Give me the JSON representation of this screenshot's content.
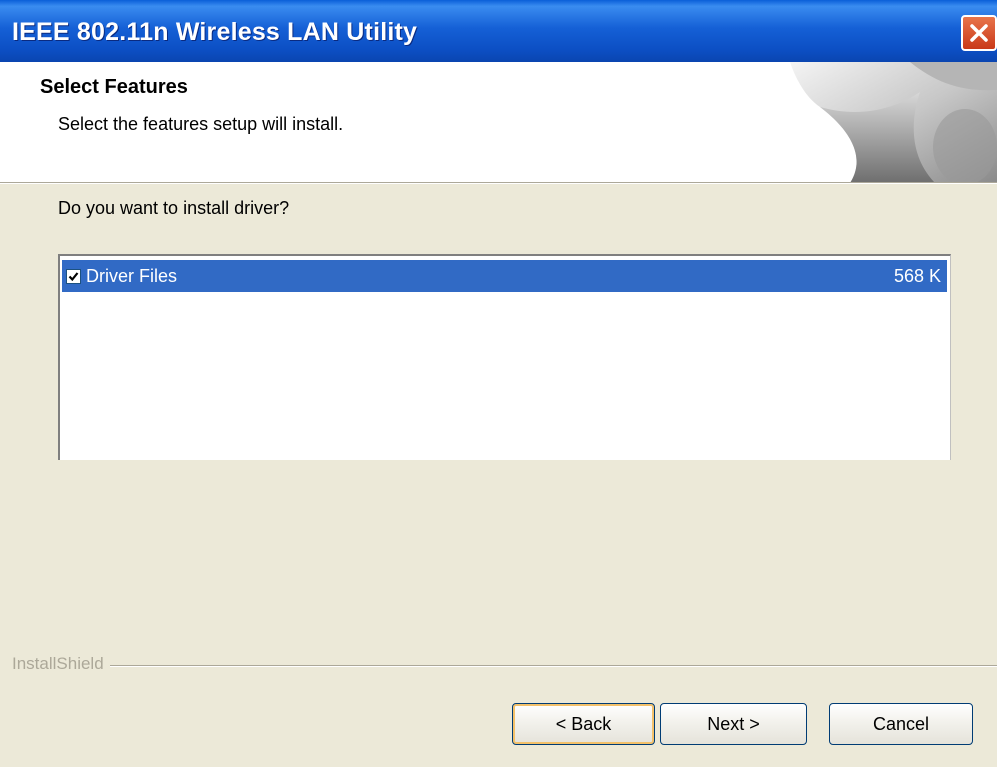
{
  "window": {
    "title": "IEEE 802.11n Wireless LAN Utility",
    "close_icon": "close-x"
  },
  "header": {
    "title": "Select Features",
    "subtitle": "Select the features setup will install."
  },
  "main": {
    "question": "Do you want to install driver?",
    "features": [
      {
        "label": "Driver Files",
        "size": "568 K",
        "checked": true,
        "selected": true
      }
    ]
  },
  "footer": {
    "brand": "InstallShield",
    "back_label": "< Back",
    "next_label": "Next >",
    "cancel_label": "Cancel"
  },
  "colors": {
    "titlebar": "#0a54cc",
    "selection": "#316ac5",
    "dialog_bg": "#ece9d8",
    "close_button": "#d9522b"
  }
}
